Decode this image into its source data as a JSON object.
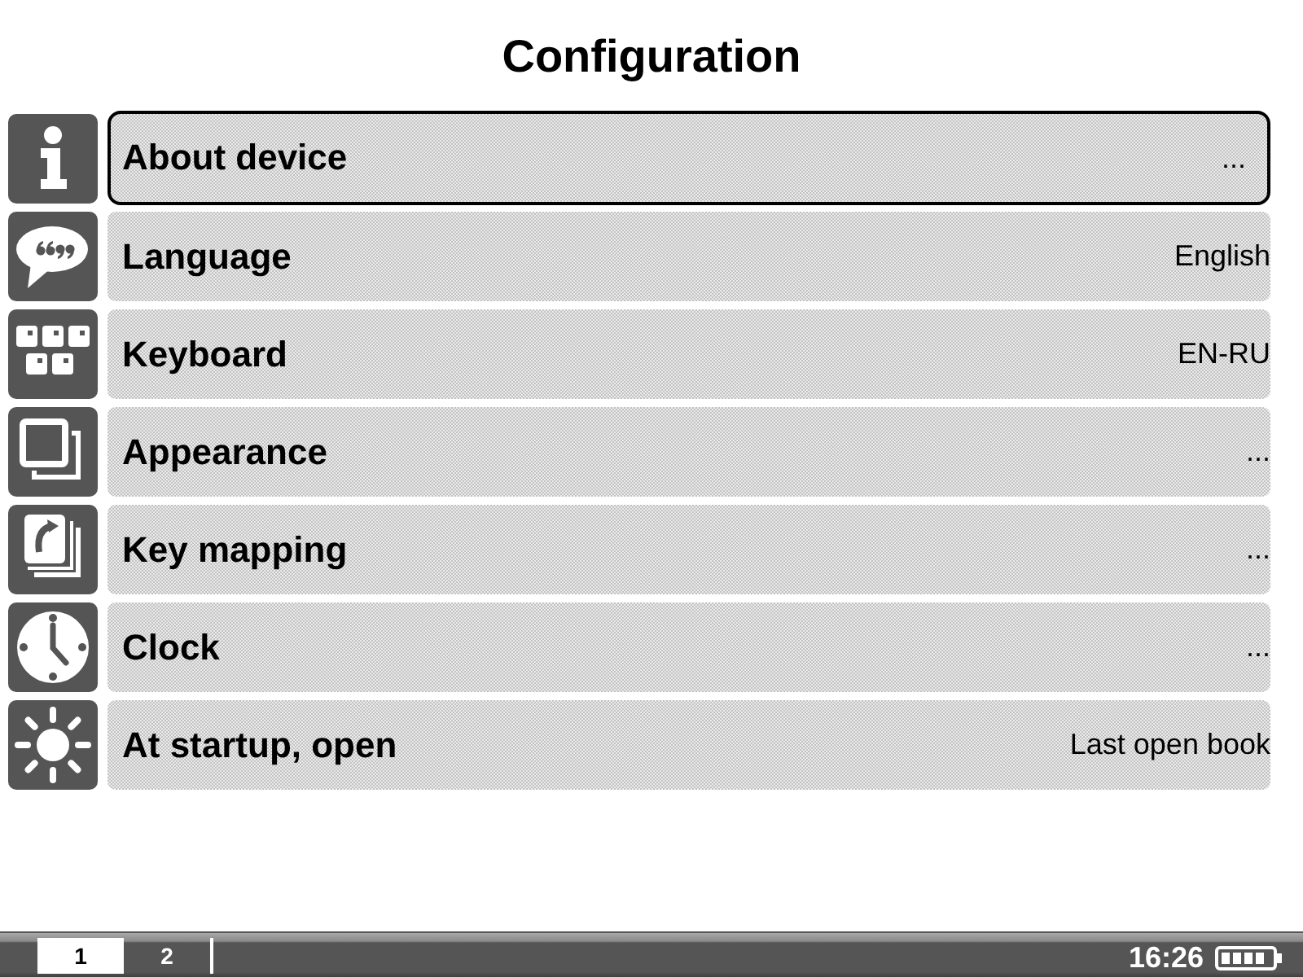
{
  "window": {
    "title": "Configuration"
  },
  "settings": [
    {
      "label": "About device",
      "value": "...",
      "selected": true
    },
    {
      "label": "Language",
      "value": "English",
      "selected": false
    },
    {
      "label": "Keyboard",
      "value": "EN-RU",
      "selected": false
    },
    {
      "label": "Appearance",
      "value": "...",
      "selected": false
    },
    {
      "label": "Key mapping",
      "value": "...",
      "selected": false
    },
    {
      "label": "Clock",
      "value": "...",
      "selected": false
    },
    {
      "label": "At startup, open",
      "value": "Last open book",
      "selected": false
    }
  ],
  "status_bar": {
    "tabs": [
      {
        "label": "1",
        "selected": true
      },
      {
        "label": "2",
        "selected": false
      }
    ],
    "time": "16:26"
  }
}
